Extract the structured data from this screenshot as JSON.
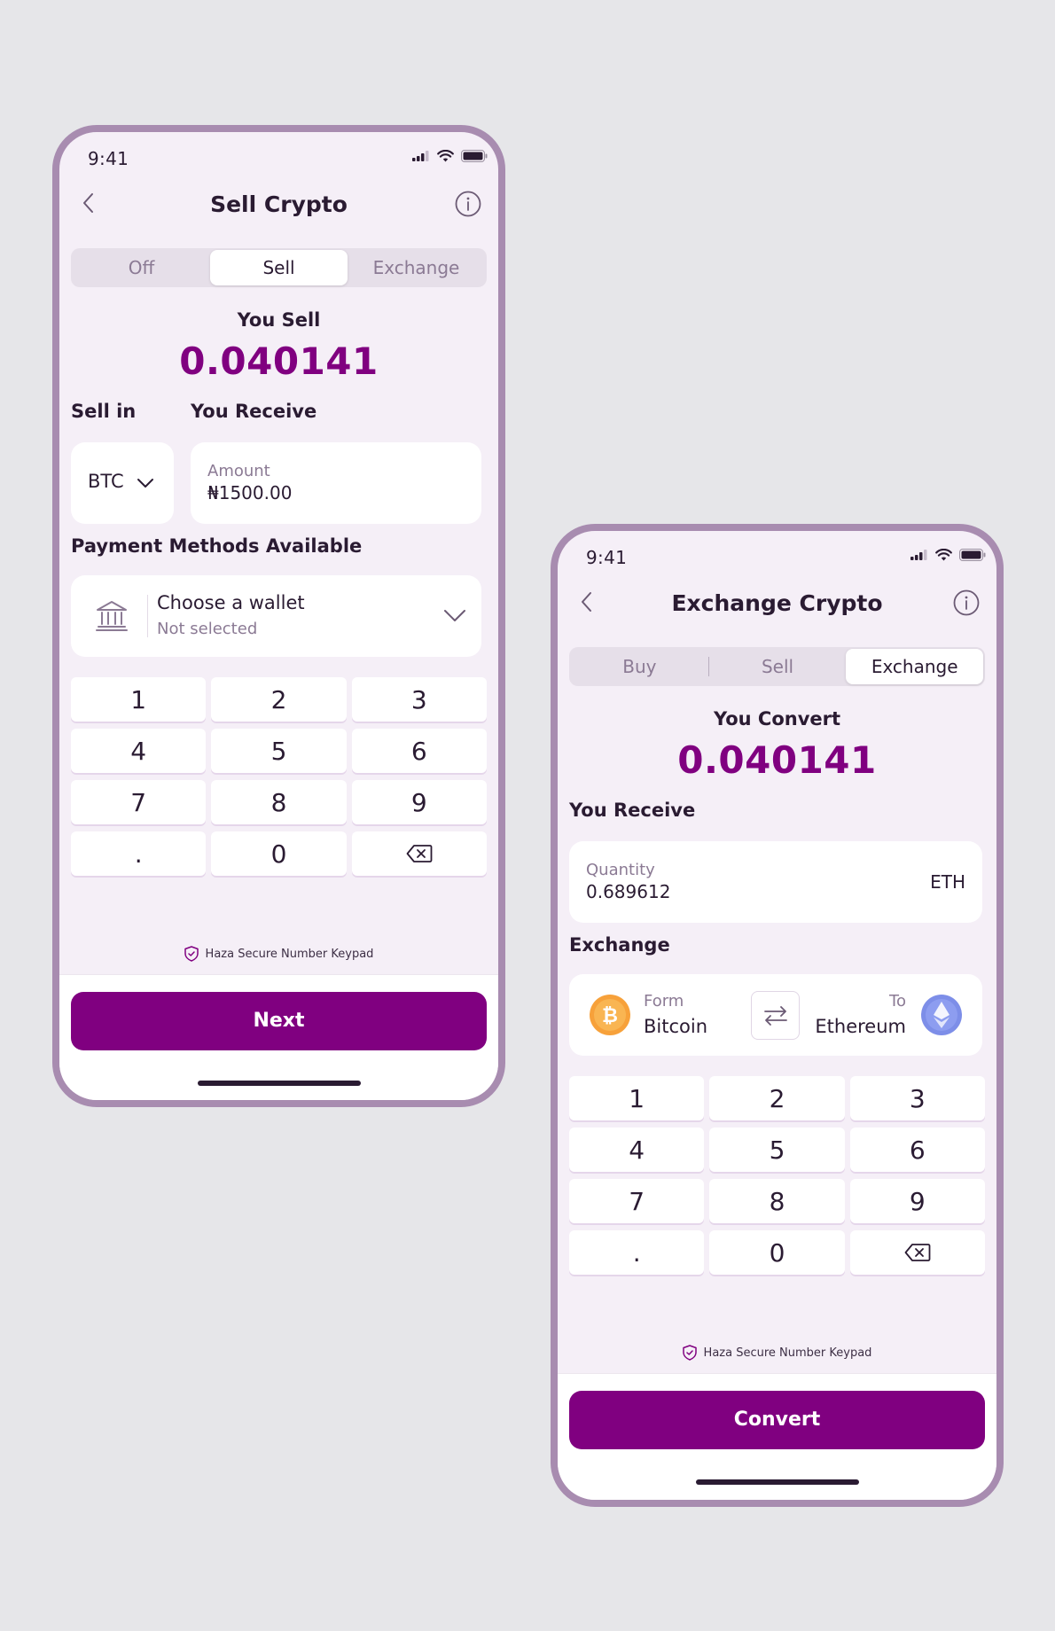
{
  "colors": {
    "brand": "#800080",
    "frame": "#a88cb0",
    "screen_bg": "#f5eff7"
  },
  "sell_screen": {
    "status_time": "9:41",
    "title": "Sell Crypto",
    "tabs": [
      "Off",
      "Sell",
      "Exchange"
    ],
    "active_tab": "Sell",
    "you_sell_label": "You Sell",
    "you_sell_value": "0.040141",
    "sell_in_label": "Sell in",
    "currency": "BTC",
    "you_receive_label": "You Receive",
    "amount_label": "Amount",
    "amount_value": "₦1500.00",
    "payment_label": "Payment Methods Available",
    "wallet_title": "Choose a wallet",
    "wallet_status": "Not selected",
    "keys": [
      "1",
      "2",
      "3",
      "4",
      "5",
      "6",
      "7",
      "8",
      "9",
      ".",
      "0"
    ],
    "secure_text": "Haza Secure Number Keypad",
    "cta": "Next"
  },
  "exchange_screen": {
    "status_time": "9:41",
    "title": "Exchange Crypto",
    "tabs": [
      "Buy",
      "Sell",
      "Exchange"
    ],
    "active_tab": "Exchange",
    "you_convert_label": "You Convert",
    "you_convert_value": "0.040141",
    "you_receive_label": "You Receive",
    "quantity_label": "Quantity",
    "quantity_value": "0.689612",
    "quantity_unit": "ETH",
    "exchange_label": "Exchange",
    "from_label": "Form",
    "from_coin": "Bitcoin",
    "to_label": "To",
    "to_coin": "Ethereum",
    "keys": [
      "1",
      "2",
      "3",
      "4",
      "5",
      "6",
      "7",
      "8",
      "9",
      ".",
      "0"
    ],
    "secure_text": "Haza Secure Number Keypad",
    "cta": "Convert"
  }
}
